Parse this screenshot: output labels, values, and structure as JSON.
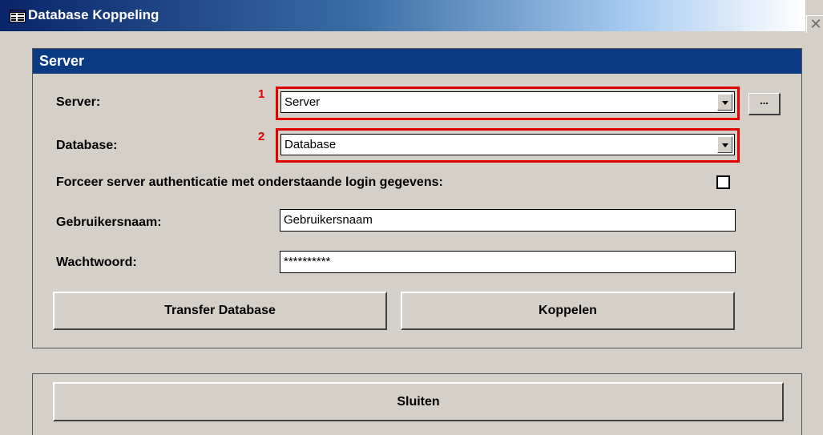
{
  "window": {
    "title": "Database Koppeling",
    "close_symbol": "✕"
  },
  "section": {
    "title": "Server"
  },
  "form": {
    "server_label": "Server:",
    "server_value": "Server",
    "server_marker": "1",
    "browse_label": "...",
    "database_label": "Database:",
    "database_value": "Database",
    "database_marker": "2",
    "force_auth_label": "Forceer server authenticatie met onderstaande login gegevens:",
    "force_auth_checked": false,
    "username_label": "Gebruikersnaam:",
    "username_value": "Gebruikersnaam",
    "password_label": "Wachtwoord:",
    "password_value": "**********"
  },
  "buttons": {
    "transfer": "Transfer Database",
    "connect": "Koppelen",
    "close": "Sluiten"
  },
  "colors": {
    "title_bar": "#0a246a",
    "section_header": "#0a3a82",
    "highlight": "#e00000",
    "face": "#d4d0c8"
  },
  "icons": {
    "title_icon": "form-icon",
    "combo_arrow": "chevron-down-icon"
  }
}
